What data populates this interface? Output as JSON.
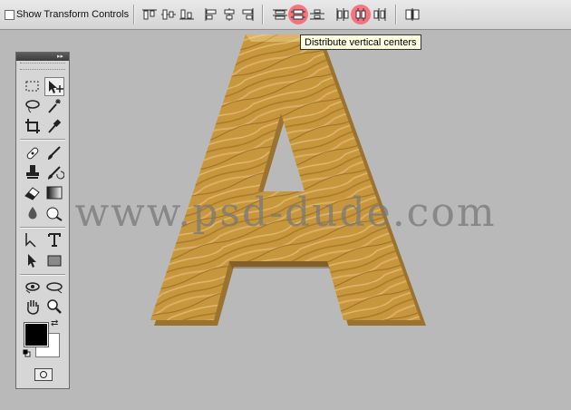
{
  "options_bar": {
    "show_transform_label": "Show Transform Controls",
    "show_transform_checked": false,
    "highlight_color": "#ff505f",
    "buttons": [
      "align-top-edges-icon",
      "align-vertical-centers-icon",
      "align-bottom-edges-icon",
      "align-left-edges-icon",
      "align-horizontal-centers-icon",
      "align-right-edges-icon",
      "distribute-top-edges-icon",
      "distribute-vertical-centers-icon",
      "distribute-bottom-edges-icon",
      "distribute-left-edges-icon",
      "distribute-horizontal-centers-icon",
      "distribute-right-edges-icon",
      "auto-align-layers-icon"
    ]
  },
  "tooltip": {
    "text": "Distribute vertical centers"
  },
  "canvas": {
    "background": "#b9b9b9",
    "letter": "A",
    "wood_color": "#c7973e",
    "watermark": "www.psd-dude.com"
  },
  "tools": [
    "rectangular-marquee-icon",
    "move-tool-icon",
    "lasso-icon",
    "magic-wand-icon",
    "crop-icon",
    "eyedropper-icon",
    "healing-brush-icon",
    "brush-icon",
    "clone-stamp-icon",
    "history-brush-icon",
    "eraser-icon",
    "gradient-icon",
    "blur-icon",
    "dodge-icon",
    "pen-icon",
    "type-icon",
    "path-selection-icon",
    "rectangle-shape-icon",
    "3d-rotate-icon",
    "3d-orbit-icon",
    "hand-icon",
    "zoom-icon"
  ],
  "colors": {
    "foreground": "#000000",
    "background": "#ffffff"
  }
}
